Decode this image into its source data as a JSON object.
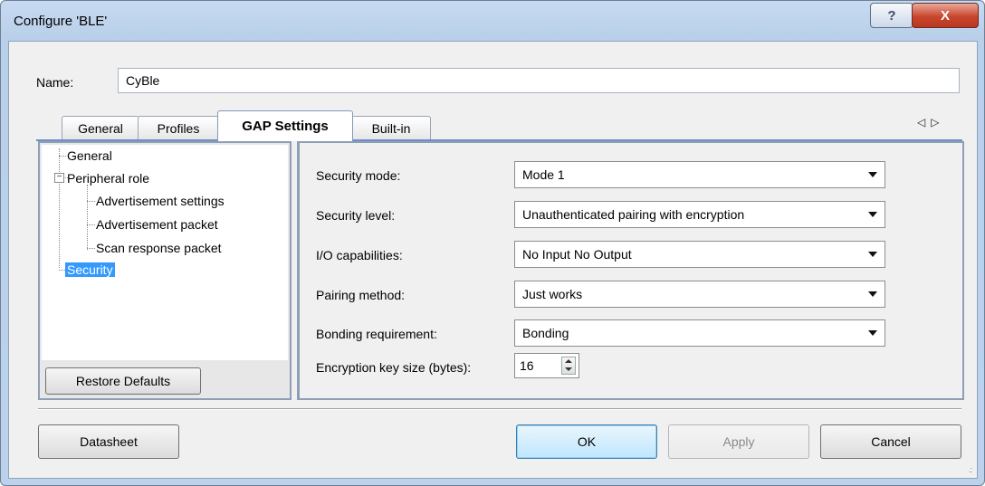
{
  "window": {
    "title": "Configure 'BLE'",
    "help_label": "?",
    "close_label": "X"
  },
  "name_row": {
    "label": "Name:",
    "value": "CyBle"
  },
  "tabs": [
    {
      "label": "General"
    },
    {
      "label": "Profiles"
    },
    {
      "label": "GAP Settings",
      "active": true
    },
    {
      "label": "Built-in"
    }
  ],
  "tab_nav": {
    "prev": "◁",
    "next": "▷"
  },
  "tree": {
    "items": [
      {
        "label": "General"
      },
      {
        "label": "Peripheral role"
      },
      {
        "label": "Advertisement settings"
      },
      {
        "label": "Advertisement packet"
      },
      {
        "label": "Scan response packet"
      },
      {
        "label": "Security",
        "selected": true
      }
    ],
    "expander": "−"
  },
  "restore_defaults_label": "Restore Defaults",
  "security": {
    "fields": [
      {
        "label": "Security mode:",
        "value": "Mode 1"
      },
      {
        "label": "Security level:",
        "value": "Unauthenticated pairing with encryption"
      },
      {
        "label": "I/O capabilities:",
        "value": "No Input No Output"
      },
      {
        "label": "Pairing method:",
        "value": "Just works"
      },
      {
        "label": "Bonding requirement:",
        "value": "Bonding"
      }
    ],
    "key_size": {
      "label": "Encryption key size (bytes):",
      "value": "16"
    }
  },
  "footer": {
    "datasheet": "Datasheet",
    "ok": "OK",
    "apply": "Apply",
    "cancel": "Cancel"
  },
  "colors": {
    "selection": "#3399ff",
    "tab_underline": "#6b8fc7",
    "close_button": "#c9462d"
  }
}
